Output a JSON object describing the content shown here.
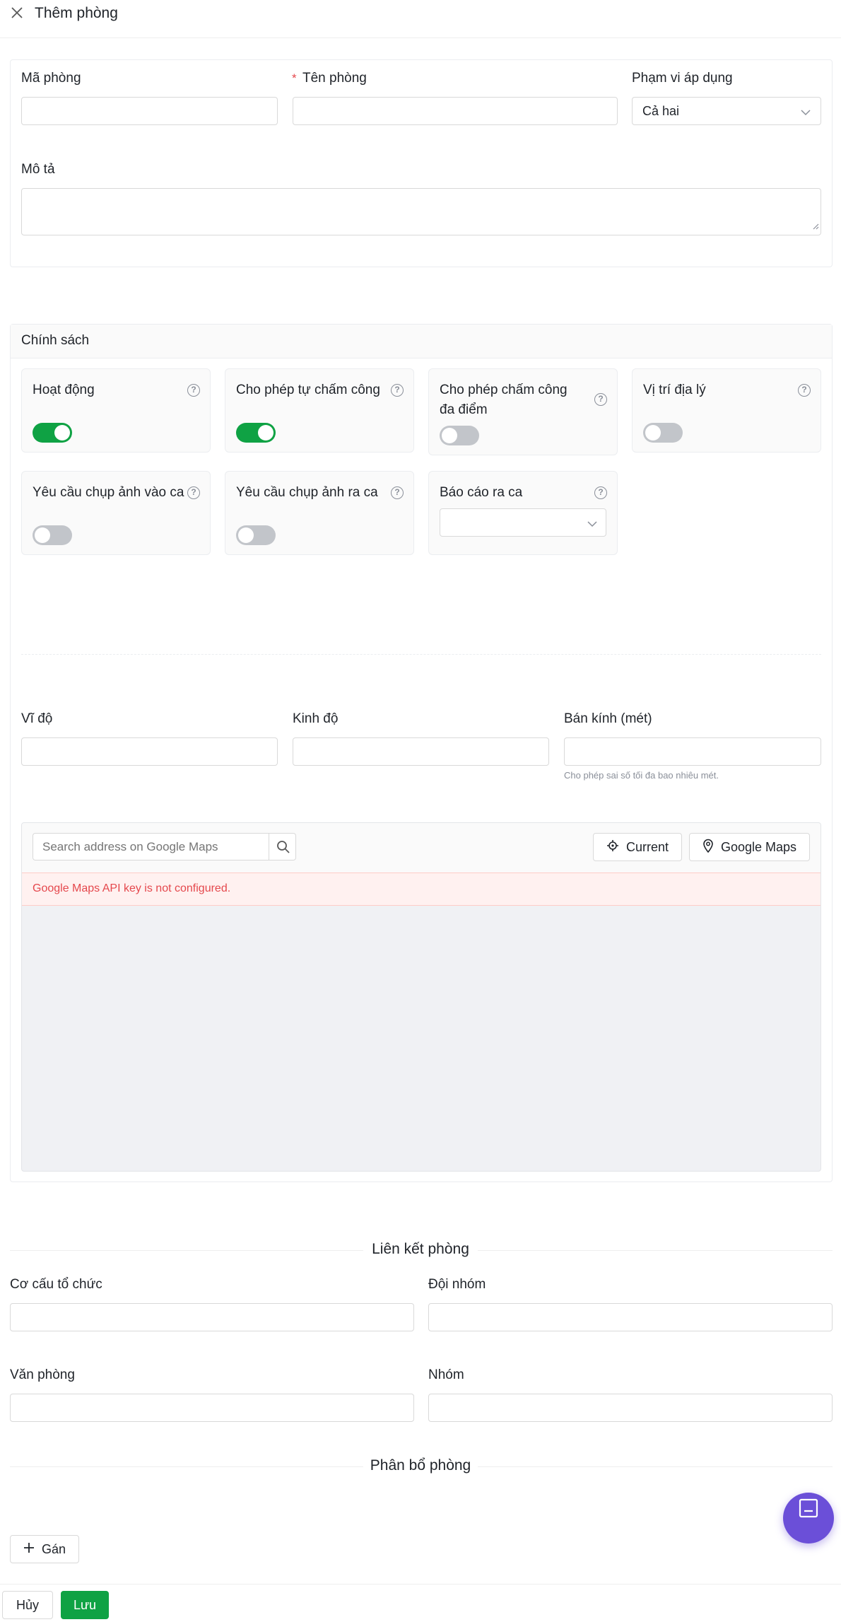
{
  "header": {
    "title": "Thêm phòng"
  },
  "form": {
    "room_code_label": "Mã phòng",
    "room_name_label": "Tên phòng",
    "required_mark": "*",
    "scope_label": "Phạm vi áp dụng",
    "scope_value": "Cả hai",
    "description_label": "Mô tả"
  },
  "policy": {
    "title": "Chính sách",
    "cards": [
      {
        "label": "Hoạt động",
        "on": true
      },
      {
        "label": "Cho phép tự chấm công",
        "on": true
      },
      {
        "label": "Cho phép chấm công đa điểm",
        "on": false
      },
      {
        "label": "Vị trí địa lý",
        "on": false
      },
      {
        "label": "Yêu cầu chụp ảnh vào ca",
        "on": false
      },
      {
        "label": "Yêu cầu chụp ảnh ra ca",
        "on": false
      },
      {
        "label": "Báo cáo ra ca"
      }
    ],
    "help_glyph": "?"
  },
  "location": {
    "lat_label": "Vĩ độ",
    "lng_label": "Kinh độ",
    "radius_label": "Bán kính (mét)",
    "radius_hint": "Cho phép sai số tối đa bao nhiêu mét."
  },
  "map": {
    "search_placeholder": "Search address on Google Maps",
    "current_label": "Current",
    "google_maps_label": "Google Maps",
    "error_text": "Google Maps API key is not configured."
  },
  "links": {
    "section_title": "Liên kết phòng",
    "org_label": "Cơ cấu tổ chức",
    "team_label": "Đội nhóm",
    "office_label": "Văn phòng",
    "group_label": "Nhóm"
  },
  "allocation": {
    "section_title": "Phân bổ phòng",
    "assign_label": "Gán"
  },
  "footer": {
    "cancel_label": "Hủy",
    "save_label": "Lưu"
  },
  "colors": {
    "primary": "#0fa244",
    "error_bg": "#fff1f0",
    "error_text": "#e5484d",
    "fab": "#6b4fd8"
  }
}
